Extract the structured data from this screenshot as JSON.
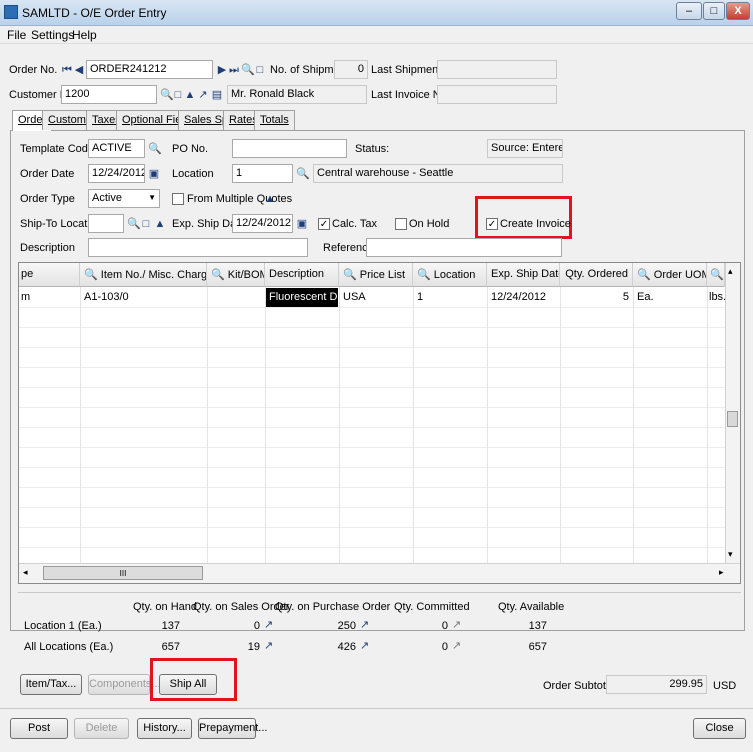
{
  "window": {
    "title": "SAMLTD - O/E Order Entry",
    "minimize": "–",
    "maximize": "□",
    "close": "X"
  },
  "menu": {
    "items": [
      "File",
      "Settings",
      "Help"
    ]
  },
  "header": {
    "order_no_label": "Order No.",
    "order_no_value": "ORDER241212",
    "no_of_shipments_label": "No. of Shipments",
    "no_of_shipments_value": "0",
    "last_shipment_label": "Last Shipment No.",
    "customer_no_label": "Customer No.",
    "customer_no_value": "1200",
    "customer_name": "Mr. Ronald Black",
    "last_invoice_label": "Last Invoice No."
  },
  "tabs": [
    {
      "label": "Order"
    },
    {
      "label": "Customer"
    },
    {
      "label": "Taxes"
    },
    {
      "label": "Optional Fields"
    },
    {
      "label": "Sales Split"
    },
    {
      "label": "Rates"
    },
    {
      "label": "Totals"
    }
  ],
  "form": {
    "template_code_label": "Template Code",
    "template_code_value": "ACTIVE",
    "po_no_label": "PO No.",
    "status_label": "Status:",
    "source": "Source: Entered",
    "order_date_label": "Order Date",
    "order_date_value": "12/24/2012",
    "location_label": "Location",
    "location_value": "1",
    "location_desc": "Central warehouse - Seattle",
    "order_type_label": "Order Type",
    "order_type_value": "Active",
    "from_multiple_quotes_label": "From Multiple Quotes",
    "ship_to_location_label": "Ship-To Location",
    "exp_ship_date_label": "Exp. Ship Date",
    "exp_ship_date_value": "12/24/2012",
    "calc_tax_label": "Calc. Tax",
    "on_hold_label": "On Hold",
    "create_invoice_label": "Create Invoice",
    "description_label": "Description",
    "reference_label": "Reference"
  },
  "grid": {
    "columns": [
      "pe",
      "Item No./ Misc. Charge",
      "Kit/BOM",
      "Description",
      "Price List",
      "Location",
      "Exp. Ship Date",
      "Qty. Ordered",
      "Order UOM",
      ""
    ],
    "rows": [
      [
        "m",
        "A1-103/0",
        "",
        "Fluorescent Des...",
        "USA",
        "1",
        "12/24/2012",
        "5",
        "Ea.",
        "lbs."
      ]
    ],
    "hscroll_thumb": "III",
    "arrow_left": "◂",
    "arrow_right": "▸",
    "arrow_up": "▴",
    "arrow_down": "▾"
  },
  "quantities": {
    "headers": [
      "Qty. on Hand",
      "Qty. on Sales Order",
      "Qty. on Purchase Order",
      "Qty. Committed",
      "Qty. Available"
    ],
    "rows": [
      {
        "label": "Location  1 (Ea.)",
        "values": [
          "137",
          "0",
          "250",
          "0",
          "137"
        ]
      },
      {
        "label": "All Locations (Ea.)",
        "values": [
          "657",
          "19",
          "426",
          "0",
          "657"
        ]
      }
    ]
  },
  "actions": {
    "item_tax": "Item/Tax...",
    "components": "Components...",
    "ship_all": "Ship All",
    "order_subtotal_label": "Order Subtotal",
    "order_subtotal_value": "299.95",
    "currency": "USD"
  },
  "footer": {
    "post": "Post",
    "delete": "Delete",
    "history": "History...",
    "prepayment": "Prepayment...",
    "close": "Close"
  },
  "icons": {
    "first": "⏮",
    "prev": "◀",
    "next": "▶",
    "last": "⏭",
    "search": "🔍",
    "new": "□",
    "up": "▲",
    "calendar": "▣",
    "drill": "↗",
    "finder": "▤",
    "dropdown": "▼",
    "check": "✓"
  },
  "colors": {
    "highlight": "#e0141d"
  }
}
